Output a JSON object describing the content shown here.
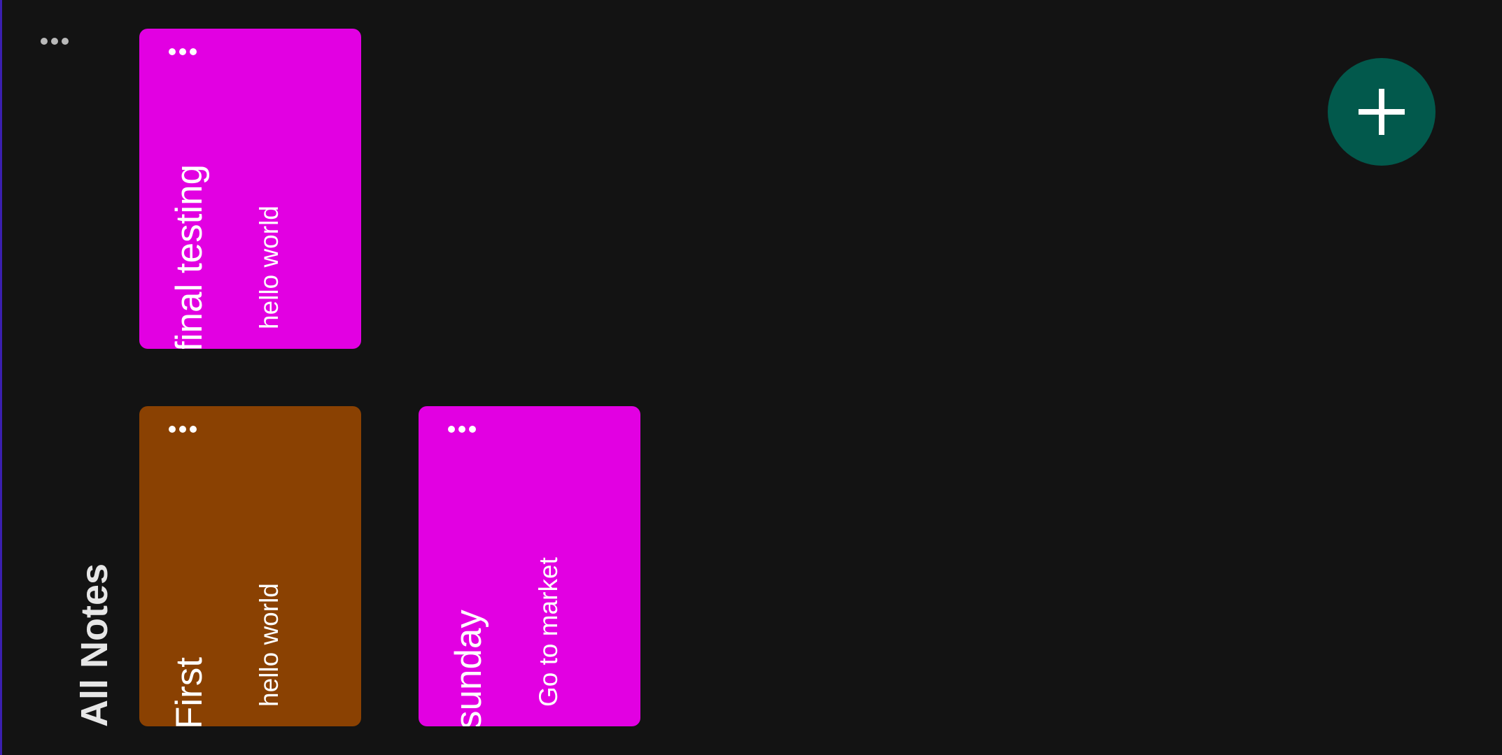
{
  "colors": {
    "background": "#131313",
    "edge_line": "#3b1fb0",
    "fab": "#02594c",
    "magenta_note": "#e200e2",
    "brown_note": "#8a4102"
  },
  "header": {
    "title": "All Notes",
    "more_icon": "more-horiz-icon"
  },
  "notes": [
    {
      "title": "final testing",
      "body": "hello world",
      "color": "#e200e2"
    },
    {
      "title": "First",
      "body": "hello world",
      "color": "#8a4102"
    },
    {
      "title": "sunday",
      "body": "Go to market",
      "color": "#e200e2"
    }
  ],
  "fab": {
    "icon": "plus-icon",
    "color": "#02594c"
  }
}
